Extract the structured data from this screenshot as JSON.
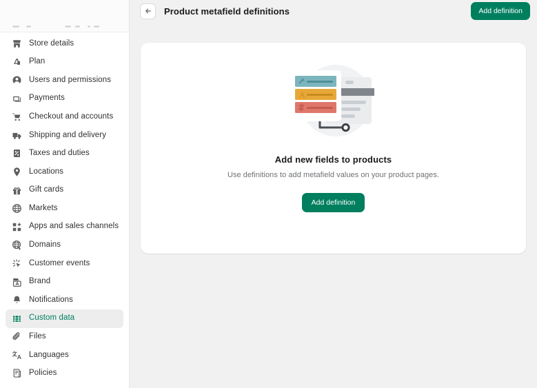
{
  "sidebar": {
    "items": [
      {
        "label": "Store details",
        "icon": "store-icon",
        "selected": false
      },
      {
        "label": "Plan",
        "icon": "plan-icon",
        "selected": false
      },
      {
        "label": "Users and permissions",
        "icon": "user-icon",
        "selected": false
      },
      {
        "label": "Payments",
        "icon": "payments-icon",
        "selected": false
      },
      {
        "label": "Checkout and accounts",
        "icon": "cart-icon",
        "selected": false
      },
      {
        "label": "Shipping and delivery",
        "icon": "truck-icon",
        "selected": false
      },
      {
        "label": "Taxes and duties",
        "icon": "tax-icon",
        "selected": false
      },
      {
        "label": "Locations",
        "icon": "location-pin-icon",
        "selected": false
      },
      {
        "label": "Gift cards",
        "icon": "gift-icon",
        "selected": false
      },
      {
        "label": "Markets",
        "icon": "globe-icon",
        "selected": false
      },
      {
        "label": "Apps and sales channels",
        "icon": "apps-grid-plus-icon",
        "selected": false
      },
      {
        "label": "Domains",
        "icon": "domains-globe-icon",
        "selected": false
      },
      {
        "label": "Customer events",
        "icon": "cursor-sparkle-icon",
        "selected": false
      },
      {
        "label": "Brand",
        "icon": "brand-icon",
        "selected": false
      },
      {
        "label": "Notifications",
        "icon": "bell-icon",
        "selected": false
      },
      {
        "label": "Custom data",
        "icon": "custom-data-icon",
        "selected": true
      },
      {
        "label": "Files",
        "icon": "paperclip-icon",
        "selected": false
      },
      {
        "label": "Languages",
        "icon": "languages-icon",
        "selected": false
      },
      {
        "label": "Policies",
        "icon": "policies-icon",
        "selected": false
      }
    ]
  },
  "header": {
    "back_icon": "arrow-left-icon",
    "title": "Product metafield definitions",
    "add_definition_label": "Add definition"
  },
  "empty_state": {
    "illustration": "metafield-definitions-illustration",
    "title": "Add new fields to products",
    "subtitle": "Use definitions to add metafield values on your product pages.",
    "add_definition_label": "Add definition"
  },
  "colors": {
    "accent_green": "#007f5f",
    "selected_bg": "#ededed",
    "page_bg": "#f1f1f1",
    "card_bg": "#ffffff",
    "text_primary": "#1a1a1a",
    "text_secondary": "#6d7175",
    "illus_teal": "#7cb5bd",
    "illus_amber": "#e8a838",
    "illus_red": "#e0776b",
    "illus_grey_dark": "#7f858b",
    "illus_grey_light": "#c9ced3"
  }
}
